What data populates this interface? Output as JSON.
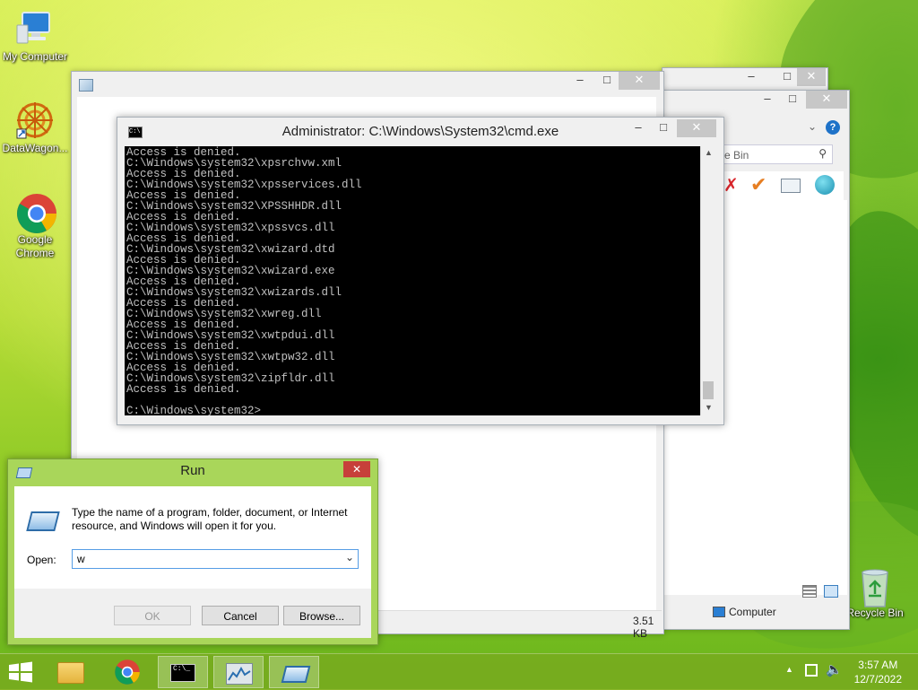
{
  "desktop": {
    "icons": [
      {
        "label": "My Computer"
      },
      {
        "label": "DataWagon..."
      },
      {
        "label": "Google Chrome"
      },
      {
        "label": "Recycle Bin"
      }
    ]
  },
  "explorer": {
    "search_placeholder": "e Bin",
    "status_size": "3.51 KB",
    "status_location": "Computer"
  },
  "cmd": {
    "title": "Administrator: C:\\Windows\\System32\\cmd.exe",
    "lines": [
      "Access is denied.",
      "C:\\Windows\\system32\\xpsrchvw.xml",
      "Access is denied.",
      "C:\\Windows\\system32\\xpsservices.dll",
      "Access is denied.",
      "C:\\Windows\\system32\\XPSSHHDR.dll",
      "Access is denied.",
      "C:\\Windows\\system32\\xpssvcs.dll",
      "Access is denied.",
      "C:\\Windows\\system32\\xwizard.dtd",
      "Access is denied.",
      "C:\\Windows\\system32\\xwizard.exe",
      "Access is denied.",
      "C:\\Windows\\system32\\xwizards.dll",
      "Access is denied.",
      "C:\\Windows\\system32\\xwreg.dll",
      "Access is denied.",
      "C:\\Windows\\system32\\xwtpdui.dll",
      "Access is denied.",
      "C:\\Windows\\system32\\xwtpw32.dll",
      "Access is denied.",
      "C:\\Windows\\system32\\zipfldr.dll",
      "Access is denied.",
      "",
      "C:\\Windows\\system32>"
    ]
  },
  "run": {
    "title": "Run",
    "description": "Type the name of a program, folder, document, or Internet resource, and Windows will open it for you.",
    "open_label": "Open:",
    "open_value": "w",
    "ok_label": "OK",
    "cancel_label": "Cancel",
    "browse_label": "Browse..."
  },
  "taskbar": {
    "time": "3:57 AM",
    "date": "12/7/2022"
  }
}
